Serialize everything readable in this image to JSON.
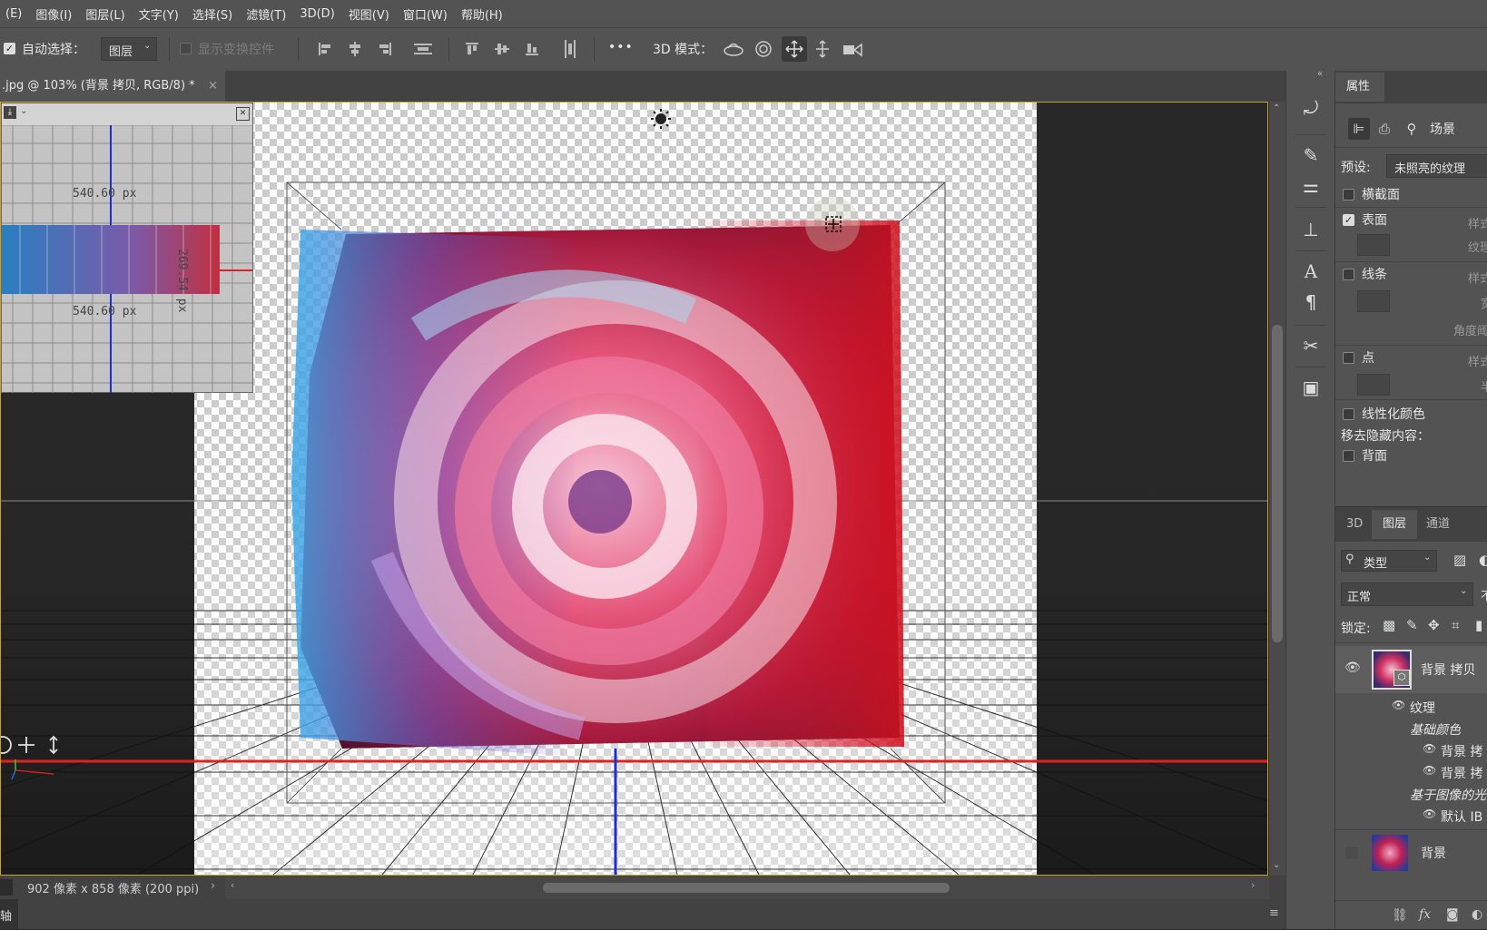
{
  "menu": [
    "(E)",
    "图像(I)",
    "图层(L)",
    "文字(Y)",
    "选择(S)",
    "滤镜(T)",
    "3D(D)",
    "视图(V)",
    "窗口(W)",
    "帮助(H)"
  ],
  "options": {
    "auto_select_label": "自动选择：",
    "auto_select_value": "图层",
    "show_transform_label": "显示变换控件",
    "more_label": "•••",
    "mode3d_label": "3D 模式："
  },
  "document": {
    "tab_title": ".jpg @ 103% (背景 拷贝, RGB/8) *",
    "close": "×"
  },
  "navigator": {
    "dim_top": "540.60 px",
    "dim_bottom": "540.60 px",
    "dim_side": "269.54 px"
  },
  "status": {
    "info": "902 像素 x 858 像素 (200 ppi)",
    "arrow": "›",
    "bottom_left": "轴"
  },
  "properties": {
    "tab": "属性",
    "scene_label": "场景",
    "preset_label": "预设:",
    "preset_value": "未照亮的纹理",
    "cross_section": "横截面",
    "surface": "表面",
    "surface_style": "样式",
    "surface_texture": "纹理",
    "lines": "线条",
    "lines_style": "样式",
    "lines_width": "宽",
    "lines_angle": "角度阈",
    "points": "点",
    "points_style": "样式",
    "points_radius": "半",
    "linearize": "线性化颜色",
    "remove_hidden": "移去隐藏内容：",
    "back_face": "背面"
  },
  "layers_panel": {
    "tabs": [
      "3D",
      "图层",
      "通道"
    ],
    "kind_label": "类型",
    "blend_mode": "正常",
    "opacity_char": "不",
    "lock_label": "锁定:",
    "layers": [
      {
        "name": "背景 拷贝",
        "visible": true
      },
      {
        "name": "纹理",
        "visible": true
      },
      {
        "name": "基础颜色",
        "visible": false
      },
      {
        "name": "背景 拷",
        "visible": true
      },
      {
        "name": "背景 拷",
        "visible": true
      },
      {
        "name": "基于图像的光",
        "visible": false
      },
      {
        "name": "默认 IB",
        "visible": true
      },
      {
        "name": "背景",
        "visible": false
      }
    ]
  },
  "colors": {
    "panel": "#535353",
    "canvas_bg": "#282828",
    "active_border": "#c9a227",
    "axis_red": "#e0211f",
    "axis_blue": "#1f2bd6"
  }
}
